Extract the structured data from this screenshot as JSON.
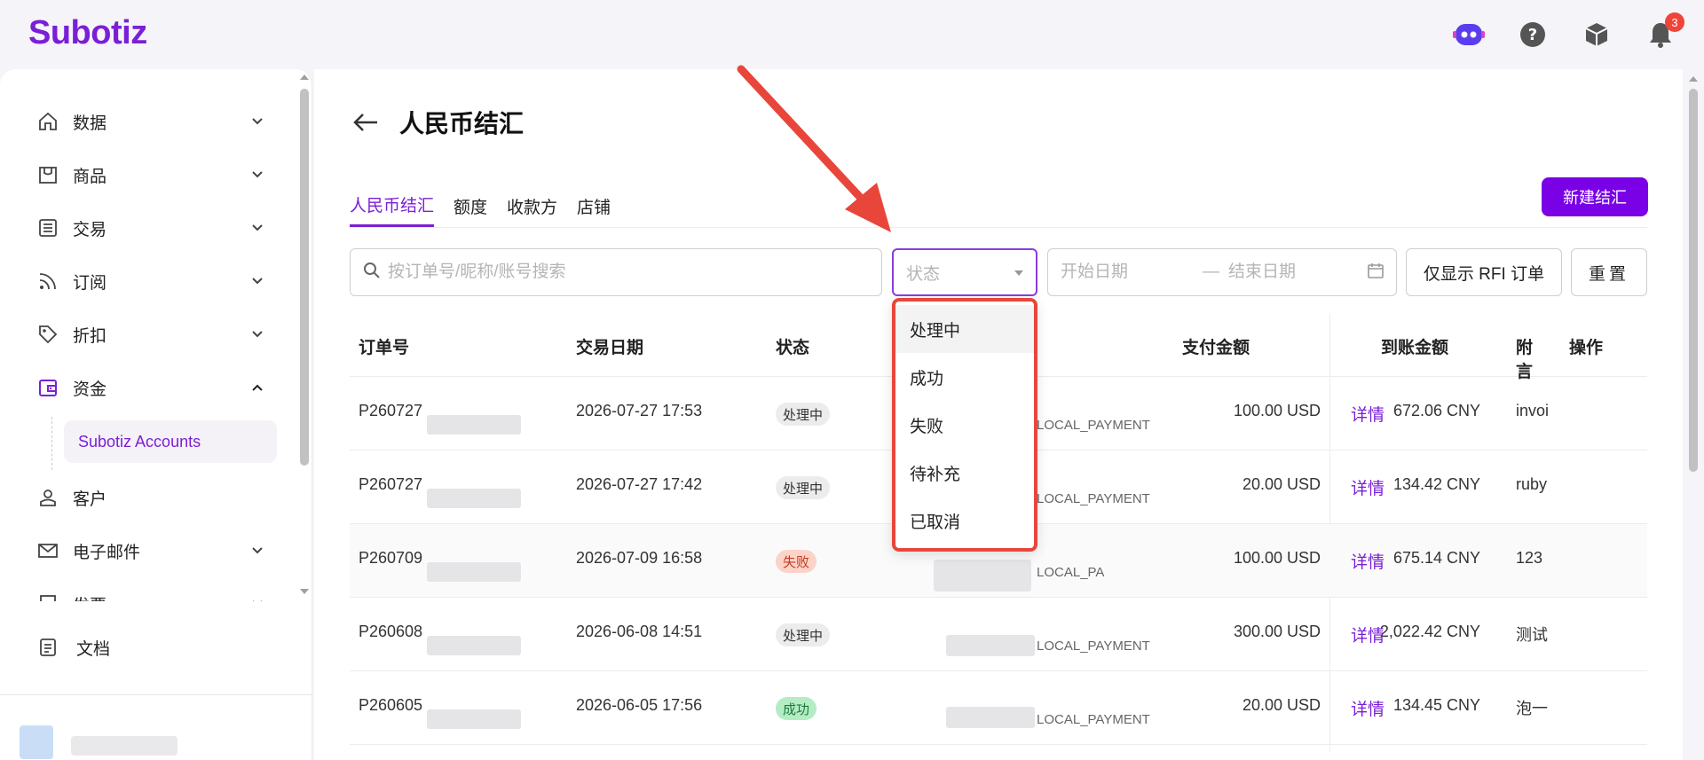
{
  "app": {
    "logo": "Subotiz",
    "notification_count": "3"
  },
  "sidebar": {
    "items": [
      {
        "label": "数据",
        "icon": "home-icon"
      },
      {
        "label": "商品",
        "icon": "store-icon"
      },
      {
        "label": "交易",
        "icon": "list-icon"
      },
      {
        "label": "订阅",
        "icon": "rss-icon"
      },
      {
        "label": "折扣",
        "icon": "tag-icon"
      },
      {
        "label": "资金",
        "icon": "wallet-icon"
      },
      {
        "label": "客户",
        "icon": "user-icon"
      },
      {
        "label": "电子邮件",
        "icon": "mail-icon"
      },
      {
        "label": "发票",
        "icon": "invoice-icon"
      }
    ],
    "sub_item": "Subotiz Accounts",
    "docs": "文档"
  },
  "page": {
    "title": "人民币结汇",
    "tabs": [
      "人民币结汇",
      "额度",
      "收款方",
      "店铺"
    ],
    "new_button": "新建结汇"
  },
  "filters": {
    "search_placeholder": "按订单号/昵称/账号搜索",
    "status_placeholder": "状态",
    "start_date_placeholder": "开始日期",
    "date_separator": "—",
    "end_date_placeholder": "结束日期",
    "rfi_button": "仅显示 RFI 订单",
    "reset_button": "重置"
  },
  "table": {
    "headers": {
      "order": "订单号",
      "date": "交易日期",
      "status": "状态",
      "pay_amount": "支付金额",
      "received_amount": "到账金额",
      "remark": "附言",
      "action": "操作"
    },
    "rows": [
      {
        "order": "P260727",
        "date": "2026-07-27 17:53",
        "status": "处理中",
        "method": "LOCAL_PAYMENT",
        "pay": "100.00 USD",
        "received": "672.06 CNY",
        "remark": "invoi",
        "action": "详情"
      },
      {
        "order": "P260727",
        "date": "2026-07-27 17:42",
        "status": "处理中",
        "method": "LOCAL_PAYMENT",
        "pay": "20.00 USD",
        "received": "134.42 CNY",
        "remark": "ruby",
        "action": "详情"
      },
      {
        "order": "P260709",
        "date": "2026-07-09 16:58",
        "status": "失败",
        "method": "LOCAL_PA",
        "pay": "100.00 USD",
        "received": "675.14 CNY",
        "remark": "123",
        "action": "详情"
      },
      {
        "order": "P260608",
        "date": "2026-06-08 14:51",
        "status": "处理中",
        "method": "LOCAL_PAYMENT",
        "pay": "300.00 USD",
        "received": "2,022.42 CNY",
        "remark": "测试",
        "action": "详情"
      },
      {
        "order": "P260605",
        "date": "2026-06-05 17:56",
        "status": "成功",
        "method": "LOCAL_PAYMENT",
        "pay": "20.00 USD",
        "received": "134.45 CNY",
        "remark": "泡一",
        "action": "详情"
      }
    ]
  },
  "status_dropdown": {
    "options": [
      "处理中",
      "成功",
      "失败",
      "待补充",
      "已取消"
    ],
    "highlighted": "处理中"
  },
  "colors": {
    "brand": "#7a00e6",
    "annotation": "#e9463b"
  }
}
